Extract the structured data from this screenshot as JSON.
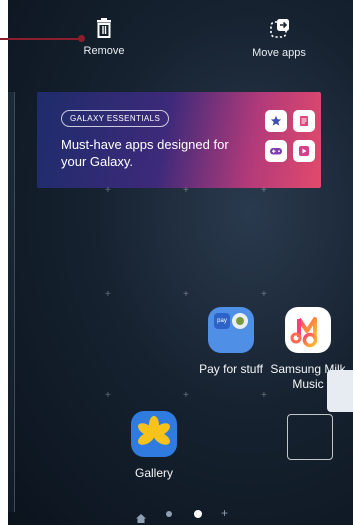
{
  "top_bar": {
    "remove_label": "Remove",
    "move_label": "Move apps"
  },
  "banner": {
    "tag": "GALAXY ESSENTIALS",
    "headline": "Must-have apps designed for your Galaxy."
  },
  "apps": [
    {
      "label": "Pay for stuff",
      "icon": "pay-for-stuff-folder-icon"
    },
    {
      "label": "Samsung Milk Music",
      "icon": "milk-music-icon"
    },
    {
      "label": "Gallery",
      "icon": "gallery-icon"
    }
  ],
  "pager": {
    "pages": [
      "home",
      "page",
      "page-current",
      "add"
    ]
  },
  "colors": {
    "callout": "#8b1d2c",
    "pay_blue": "#4f8fe6",
    "gallery_blue": "#2f7be0",
    "gallery_yellow": "#f7c21a"
  }
}
